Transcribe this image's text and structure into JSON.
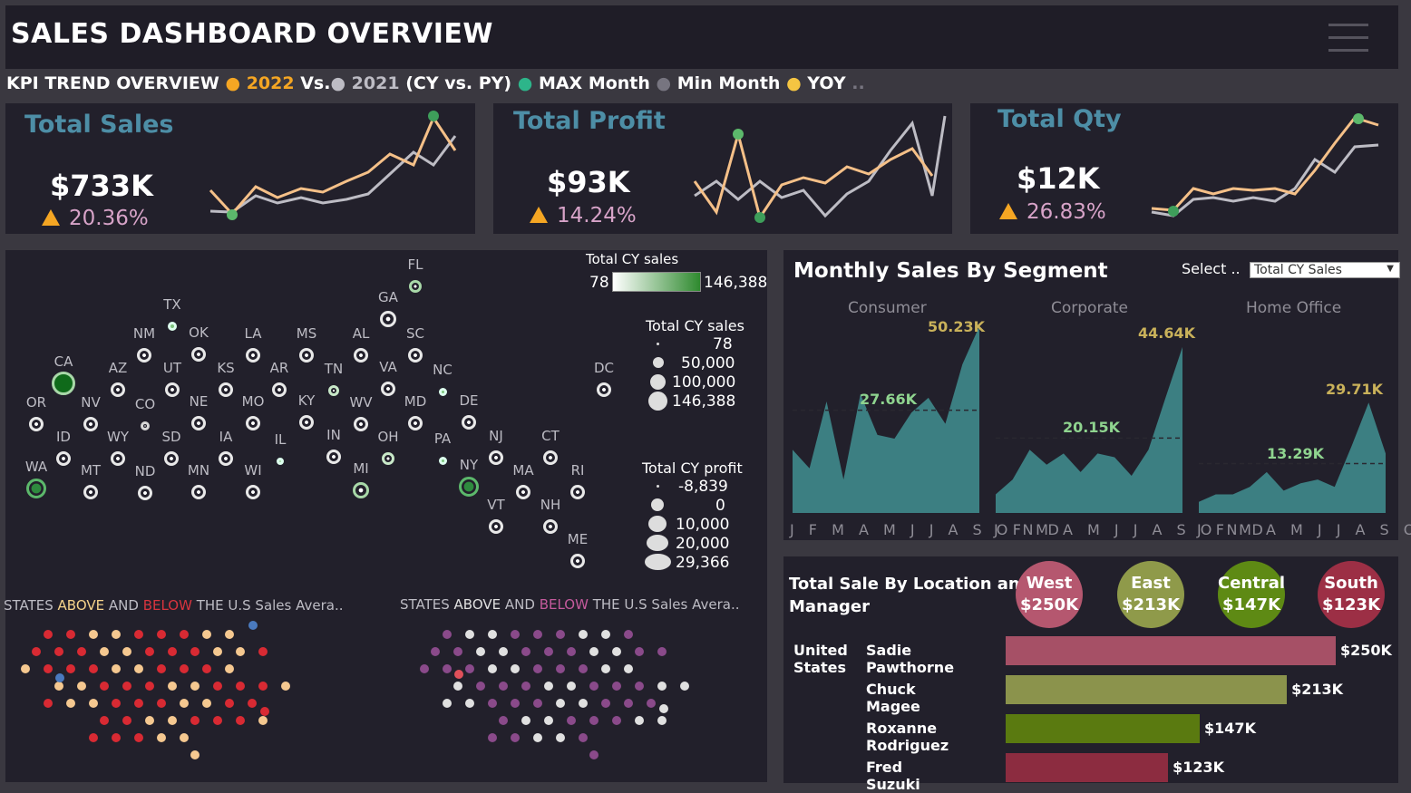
{
  "header": {
    "title": "SALES DASHBOARD OVERVIEW"
  },
  "subtitle": {
    "prefix": "KPI TREND OVERVIEW",
    "cy": "2022",
    "vs": "Vs.",
    "py": "2021",
    "cy_py": "(CY vs. PY)",
    "max": "MAX Month",
    "min": "Min Month",
    "yoy": "YOY",
    "more": "..",
    "colors": {
      "cy": "#f5a623",
      "py": "#bdbcc4",
      "max": "#2db58a",
      "min": "#777580",
      "yoy": "#f5c542"
    }
  },
  "kpis": [
    {
      "title": "Total  Sales",
      "value": "$733K",
      "pct": "20.36%"
    },
    {
      "title": "Total Profit",
      "value": "$93K",
      "pct": "14.24%"
    },
    {
      "title": "Total Qty",
      "value": "$12K",
      "pct": "26.83%"
    }
  ],
  "map": {
    "legend_sales": {
      "title": "Total CY sales",
      "min": "78",
      "max": "146,388"
    },
    "legend_size_sales": {
      "title": "Total CY sales",
      "items": [
        "78",
        "50,000",
        "100,000",
        "146,388"
      ]
    },
    "legend_profit": {
      "title": "Total CY profit",
      "items": [
        "-8,839",
        "0",
        "10,000",
        "20,000",
        "29,366"
      ]
    },
    "states": [
      "FL",
      "GA",
      "TX",
      "NM",
      "OK",
      "LA",
      "MS",
      "AL",
      "SC",
      "CA",
      "AZ",
      "UT",
      "KS",
      "AR",
      "TN",
      "VA",
      "NC",
      "DC",
      "OR",
      "NV",
      "CO",
      "NE",
      "MO",
      "KY",
      "WV",
      "MD",
      "DE",
      "ID",
      "WY",
      "SD",
      "IA",
      "IL",
      "IN",
      "OH",
      "PA",
      "NJ",
      "CT",
      "WA",
      "MT",
      "ND",
      "MN",
      "WI",
      "MI",
      "NY",
      "MA",
      "RI",
      "VT",
      "NH",
      "ME"
    ]
  },
  "mini_maps": {
    "left": {
      "p1": "STATES ",
      "above": "ABOVE",
      "and": " AND ",
      "below": "BELOW",
      "rest": " THE U.S  Sales Avera.."
    },
    "right": {
      "p1": "STATES ",
      "above": "ABOVE",
      "and": " AND ",
      "below": "BELOW",
      "rest": " THE U.S  Sales Avera.."
    }
  },
  "segments": {
    "title": "Monthly Sales By Segment",
    "select_label": "Select ..",
    "select_value": "Total CY Sales",
    "months_axis": "J F M A M J J A S O N D",
    "panels": [
      {
        "name": "Consumer",
        "max_label": "50.23K",
        "avg_label": "27.66K",
        "max": 50.23,
        "avg": 27.66,
        "values": [
          17,
          12,
          30,
          9,
          32,
          21,
          20,
          27,
          31,
          24,
          40,
          50.23
        ]
      },
      {
        "name": "Corporate",
        "max_label": "44.64K",
        "avg_label": "20.15K",
        "max": 44.64,
        "avg": 20.15,
        "values": [
          5,
          9,
          17,
          13,
          16,
          11,
          16,
          15,
          10,
          17,
          31,
          44.64
        ]
      },
      {
        "name": "Home Office",
        "max_label": "29.71K",
        "avg_label": "13.29K",
        "max": 29.71,
        "avg": 13.29,
        "values": [
          3,
          5,
          5,
          7,
          11,
          6,
          8,
          9,
          7,
          18,
          29.71,
          16
        ]
      }
    ]
  },
  "location": {
    "title_line1": "Total Sale By Location and",
    "title_line2": "Manager",
    "country_line1": "United",
    "country_line2": "States",
    "regions": [
      {
        "name": "West",
        "value": "$250K",
        "color": "#b5576f"
      },
      {
        "name": "East",
        "value": "$213K",
        "color": "#8f9a4a"
      },
      {
        "name": "Central",
        "value": "$147K",
        "color": "#5e8a14"
      },
      {
        "name": "South",
        "value": "$123K",
        "color": "#9c2f45"
      }
    ],
    "managers": [
      {
        "name": "Sadie Pawthorne",
        "value": "$250K",
        "amount": 250,
        "color": "#a65066"
      },
      {
        "name": "Chuck Magee",
        "value": "$213K",
        "amount": 213,
        "color": "#8b934c"
      },
      {
        "name": "Roxanne Rodriguez",
        "value": "$147K",
        "amount": 147,
        "color": "#5a7a10"
      },
      {
        "name": "Fred Suzuki",
        "value": "$123K",
        "amount": 123,
        "color": "#8c2c40"
      }
    ]
  }
}
